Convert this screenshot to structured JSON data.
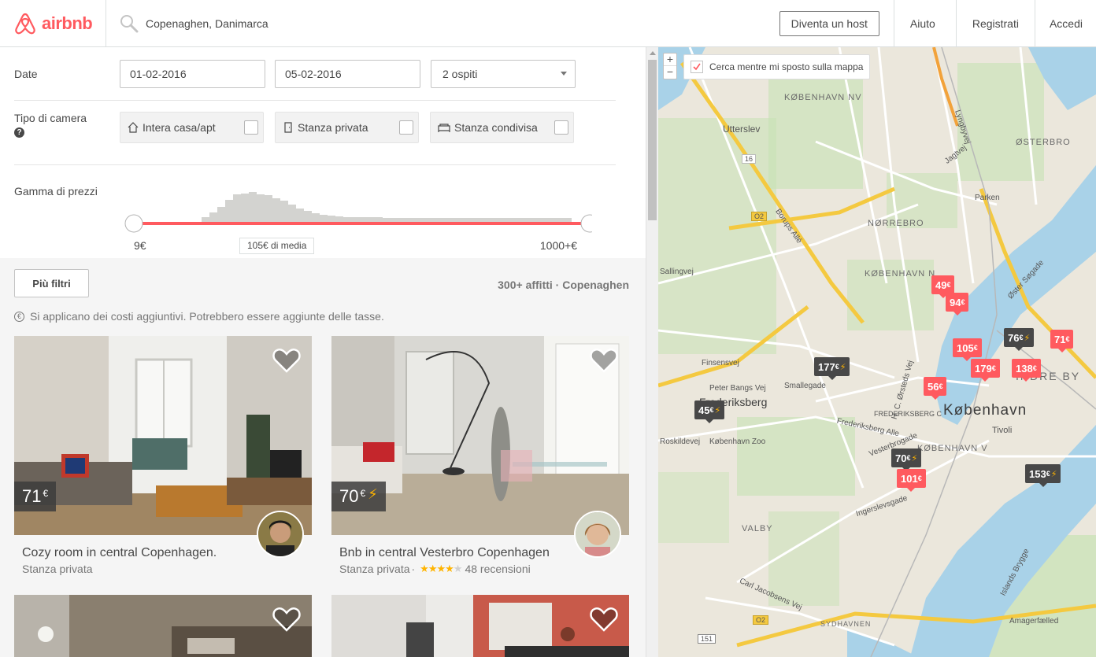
{
  "header": {
    "logo": "airbnb",
    "search_value": "Copenaghen, Danimarca",
    "host_button": "Diventa un host",
    "nav": [
      "Aiuto",
      "Registrati",
      "Accedi"
    ]
  },
  "filters": {
    "date_label": "Date",
    "checkin": "01-02-2016",
    "checkout": "05-02-2016",
    "guests": "2 ospiti",
    "room_type_label": "Tipo di camera",
    "room_types": [
      "Intera casa/apt",
      "Stanza privata",
      "Stanza condivisa"
    ],
    "price_label": "Gamma di prezzi",
    "price_min": "9€",
    "price_max": "1000+€",
    "price_avg": "105€ di media"
  },
  "results": {
    "more_filters": "Più filtri",
    "count": "300+ affitti · Copenaghen",
    "fees_note": "Si applicano dei costi aggiuntivi. Potrebbero essere aggiunte delle tasse.",
    "listings": [
      {
        "price": "71",
        "currency": "€",
        "instant": false,
        "title": "Cozy room in central Copenhagen.",
        "type": "Stanza privata",
        "rating": null,
        "reviews": ""
      },
      {
        "price": "70",
        "currency": "€",
        "instant": true,
        "title": "Bnb in central Vesterbro Copenhagen",
        "type": "Stanza privata",
        "rating": 4,
        "reviews": "48 recensioni"
      }
    ]
  },
  "map": {
    "search_as_move": "Cerca mentre mi sposto sulla mappa",
    "zoom_in": "+",
    "zoom_out": "−",
    "labels": {
      "kbh_nv": "KØBENHAVN NV",
      "utterslev": "Utterslev",
      "osterbro": "ØSTERBRO",
      "norrebro": "NØRREBRO",
      "kbh_n": "KØBENHAVN N",
      "frederiksberg": "Frederiksberg",
      "frederiksberg_c": "FREDERIKSBERG C",
      "kobenhavn": "København",
      "kbh_v": "KØBENHAVN V",
      "indre_by": "INDRE BY",
      "tivoli": "Tivoli",
      "zoo": "København Zoo",
      "valby": "VALBY",
      "sydhavnen": "SYDHAVNEN",
      "amagerfaelled": "Amagerfælled",
      "parken": "Parken",
      "finsensvej": "Finsensvej",
      "peter_bangs": "Peter Bangs Vej",
      "smallegade": "Smallegade",
      "sallingvej": "Sallingvej",
      "roskildevej": "Roskildevej",
      "ingerslevsgade": "Ingerslevsgade",
      "vesterbrogade": "Vesterbrogade",
      "frederiksberg_alle": "Frederiksberg Alle",
      "jagtvej": "Jagtvej",
      "borups_alle": "Borups Allé",
      "lyngbyvej": "Lyngbyvej",
      "oster_sogade": "Øster Søgade",
      "islands_brygge": "Islands Brygge",
      "carl_jacobsens": "Carl Jacobsens Vej",
      "hc_orsteds": "H. C. Ørsteds Vej",
      "road16": "16",
      "road02a": "O2",
      "road02b": "O2",
      "road151": "151"
    },
    "markers": [
      {
        "price": "49",
        "kind": "red"
      },
      {
        "price": "94",
        "kind": "red"
      },
      {
        "price": "105",
        "kind": "red"
      },
      {
        "price": "76",
        "kind": "dark",
        "instant": true
      },
      {
        "price": "71",
        "kind": "red"
      },
      {
        "price": "179",
        "kind": "red"
      },
      {
        "price": "138",
        "kind": "red"
      },
      {
        "price": "177",
        "kind": "dark",
        "instant": true
      },
      {
        "price": "56",
        "kind": "red"
      },
      {
        "price": "45",
        "kind": "dark",
        "instant": true
      },
      {
        "price": "70",
        "kind": "dark",
        "instant": true
      },
      {
        "price": "101",
        "kind": "red"
      },
      {
        "price": "153",
        "kind": "dark",
        "instant": true
      }
    ],
    "currency": "€"
  },
  "colors": {
    "brand": "#ff5a5f",
    "text": "#484848",
    "muted": "#767676",
    "star": "#ffb400"
  }
}
